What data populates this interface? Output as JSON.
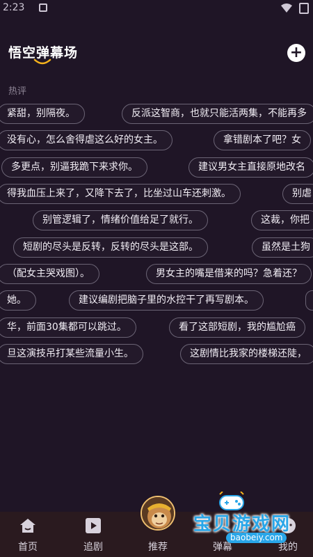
{
  "status_bar": {
    "time": "2:23"
  },
  "header": {
    "title": "悟空弹幕场",
    "add_icon": "plus-circle-icon"
  },
  "section": {
    "label": "热评"
  },
  "danmaku": [
    "紧甜，别隔夜。",
    "反派这智商，也就只能活两集，不能再多",
    "没有心，怎么舍得虐这么好的女主。",
    "拿错剧本了吧？女",
    "多更点，别逼我跪下来求你。",
    "建议男女主直接原地改名",
    "得我血压上来了，又降下去了，比坐过山车还刺激。",
    "别虐",
    "别管逻辑了，情绪价值给足了就行。",
    "这裁，你把",
    "短剧的尽头是反转，反转的尽头是这部。",
    "虽然是土狗",
    "（配女主哭戏图）。",
    "男女主的嘴是借来的吗？急着还？",
    "她。",
    "建议编剧把脑子里的水控干了再写剧本。",
    "华，前面30集都可以跳过。",
    "看了这部短剧，我的尴尬癌",
    "旦这演技吊打某些流量小生。",
    "这剧情比我家的楼梯还陡，"
  ],
  "bottom_nav": {
    "items": [
      {
        "label": "首页",
        "icon": "home-icon"
      },
      {
        "label": "追剧",
        "icon": "play-icon"
      },
      {
        "label": "推荐",
        "icon": "avatar-icon"
      },
      {
        "label": "弹幕",
        "icon": "danmaku-icon"
      },
      {
        "label": "我的",
        "icon": "user-icon"
      }
    ]
  },
  "watermark": {
    "text": "宝贝游戏网",
    "url": "baobeiy.com"
  },
  "colors": {
    "background": "#1f1526",
    "pill_border": "#6b6475",
    "nav_background": "#2a1a1f",
    "accent": "#f5b21c",
    "watermark": "#29a6e8"
  }
}
